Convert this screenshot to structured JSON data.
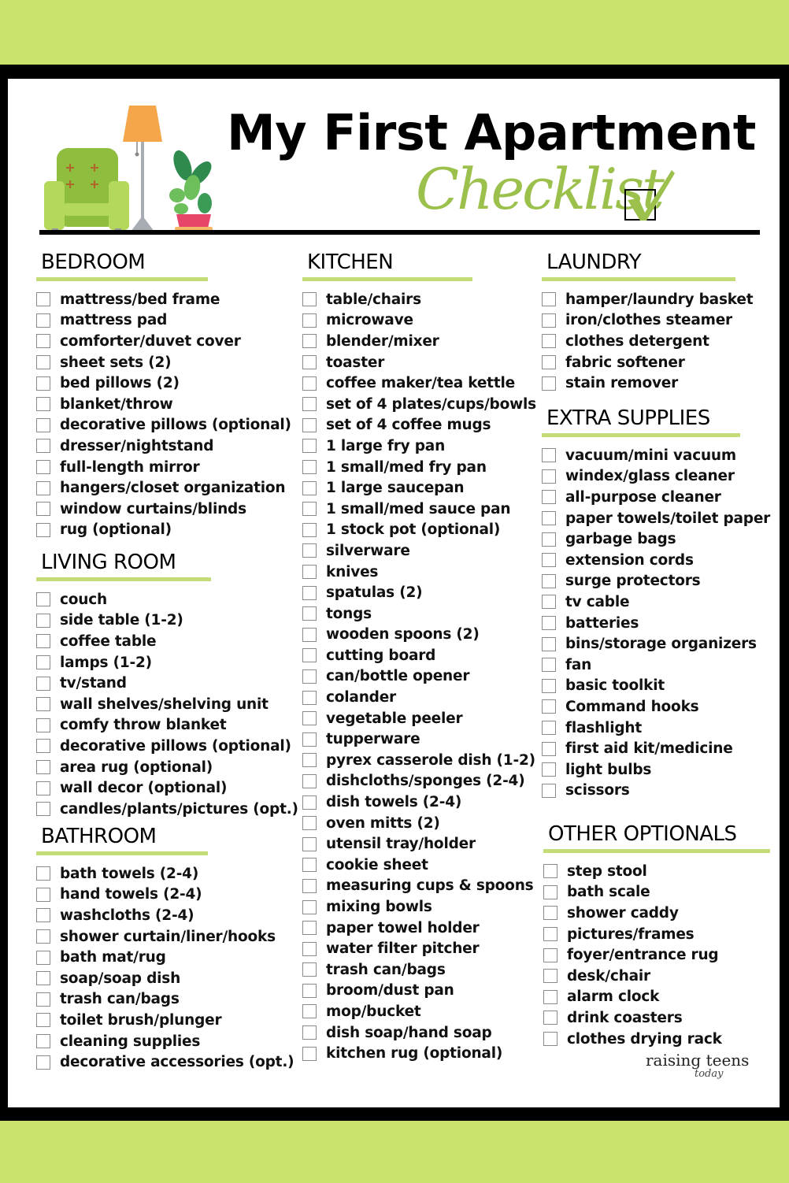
{
  "header": {
    "title": "My First Apartment",
    "subtitle": "Checklist"
  },
  "colors": {
    "accent_green": "#c9e26c",
    "script_green": "#9cc04c",
    "rule_green": "#c3dc78",
    "frame": "#000000"
  },
  "sections": {
    "bedroom": {
      "title": "BEDROOM",
      "items": [
        "mattress/bed frame",
        "mattress pad",
        "comforter/duvet cover",
        "sheet sets (2)",
        "bed pillows (2)",
        "blanket/throw",
        "decorative pillows (optional)",
        "dresser/nightstand",
        "full-length mirror",
        "hangers/closet organization",
        "window curtains/blinds",
        "rug (optional)"
      ]
    },
    "living_room": {
      "title": "LIVING ROOM",
      "items": [
        "couch",
        "side table (1-2)",
        "coffee table",
        "lamps (1-2)",
        "tv/stand",
        "wall shelves/shelving unit",
        "comfy throw blanket",
        "decorative pillows (optional)",
        "area rug (optional)",
        "wall decor (optional)",
        "candles/plants/pictures (opt.)"
      ]
    },
    "bathroom": {
      "title": "BATHROOM",
      "items": [
        "bath towels (2-4)",
        "hand towels (2-4)",
        "washcloths (2-4)",
        "shower curtain/liner/hooks",
        "bath mat/rug",
        "soap/soap dish",
        "trash can/bags",
        "toilet brush/plunger",
        "cleaning supplies",
        "decorative accessories (opt.)"
      ]
    },
    "kitchen": {
      "title": "KITCHEN",
      "items": [
        "table/chairs",
        "microwave",
        "blender/mixer",
        "toaster",
        "coffee maker/tea kettle",
        "set of 4 plates/cups/bowls",
        "set of 4 coffee mugs",
        "1 large fry pan",
        "1 small/med fry pan",
        "1 large saucepan",
        "1 small/med sauce pan",
        "1 stock pot (optional)",
        "silverware",
        "knives",
        "spatulas (2)",
        "tongs",
        "wooden spoons (2)",
        "cutting board",
        "can/bottle opener",
        "colander",
        "vegetable peeler",
        "tupperware",
        "pyrex casserole dish (1-2)",
        "dishcloths/sponges (2-4)",
        "dish towels (2-4)",
        "oven mitts (2)",
        "utensil tray/holder",
        "cookie sheet",
        "measuring cups & spoons",
        "mixing bowls",
        "paper towel holder",
        "water filter pitcher",
        "trash can/bags",
        "broom/dust pan",
        "mop/bucket",
        "dish soap/hand soap",
        "kitchen rug (optional)"
      ]
    },
    "laundry": {
      "title": "LAUNDRY",
      "items": [
        "hamper/laundry basket",
        "iron/clothes steamer",
        "clothes detergent",
        "fabric softener",
        "stain remover"
      ]
    },
    "extra_supplies": {
      "title": "EXTRA SUPPLIES",
      "items": [
        "vacuum/mini vacuum",
        "windex/glass cleaner",
        "all-purpose cleaner",
        "paper towels/toilet paper",
        "garbage bags",
        "extension cords",
        "surge protectors",
        "tv cable",
        "batteries",
        "bins/storage organizers",
        "fan",
        "basic toolkit",
        "Command hooks",
        "flashlight",
        "first aid kit/medicine",
        "light bulbs",
        "scissors"
      ]
    },
    "other_optionals": {
      "title": "OTHER OPTIONALS",
      "items": [
        "step stool",
        "bath scale",
        "shower caddy",
        "pictures/frames",
        "foyer/entrance rug",
        "desk/chair",
        "alarm clock",
        "drink coasters",
        "clothes drying rack"
      ]
    }
  },
  "brand": {
    "name": "raising teens",
    "tagline": "today"
  }
}
